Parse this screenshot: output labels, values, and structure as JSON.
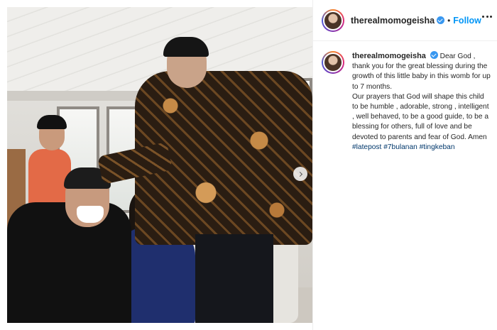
{
  "post": {
    "author": "therealmomogeisha",
    "follow_label": "Follow",
    "separator": "•",
    "next_icon": "chevron-right-icon",
    "more_icon": "more-options-icon",
    "verified_color": "#3897f0",
    "follow_color": "#0095f6"
  },
  "caption": {
    "username": "therealmomogeisha",
    "line1": "Dear God , thank you for the great blessing during the growth of this little baby in this womb for up to 7 months.",
    "line2": "Our prayers that God will shape this child to be humble , adorable, strong , intelligent , well behaved, to be a good guide, to be a blessing for others, full of love and be devoted to parents and fear of God. Amen",
    "hashtags": [
      "#latepost",
      "#7bulanan",
      "#tingkeban"
    ]
  }
}
